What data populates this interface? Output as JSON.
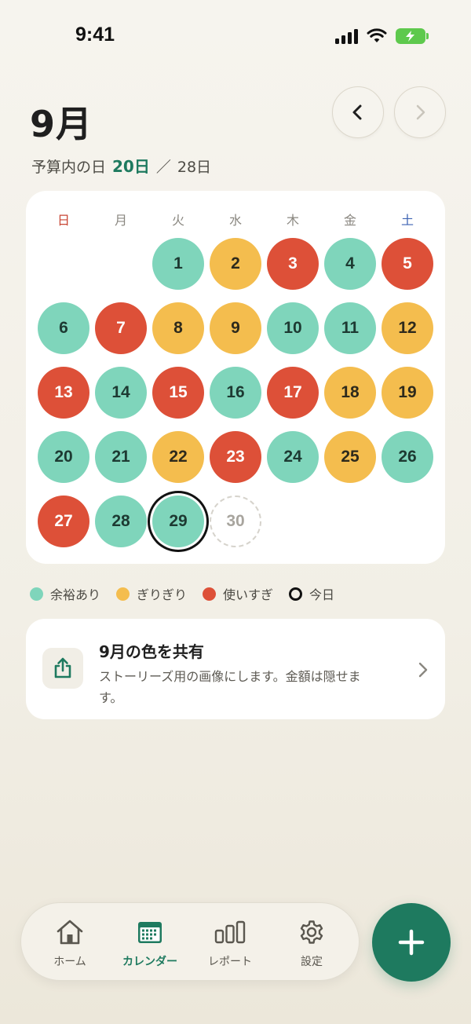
{
  "status_bar": {
    "time": "9:41"
  },
  "header": {
    "month_title": "9月",
    "budget_label": "予算内の日",
    "budget_days": "20日",
    "separator": "／",
    "total_days": "28日"
  },
  "calendar": {
    "weekdays": [
      "日",
      "月",
      "火",
      "水",
      "木",
      "金",
      "土"
    ],
    "days": [
      {
        "n": "1",
        "status": "green"
      },
      {
        "n": "2",
        "status": "yellow"
      },
      {
        "n": "3",
        "status": "red"
      },
      {
        "n": "4",
        "status": "green"
      },
      {
        "n": "5",
        "status": "red"
      },
      {
        "n": "6",
        "status": "green"
      },
      {
        "n": "7",
        "status": "red"
      },
      {
        "n": "8",
        "status": "yellow"
      },
      {
        "n": "9",
        "status": "yellow"
      },
      {
        "n": "10",
        "status": "green"
      },
      {
        "n": "11",
        "status": "green"
      },
      {
        "n": "12",
        "status": "yellow"
      },
      {
        "n": "13",
        "status": "red"
      },
      {
        "n": "14",
        "status": "green"
      },
      {
        "n": "15",
        "status": "red"
      },
      {
        "n": "16",
        "status": "green"
      },
      {
        "n": "17",
        "status": "red"
      },
      {
        "n": "18",
        "status": "yellow"
      },
      {
        "n": "19",
        "status": "yellow"
      },
      {
        "n": "20",
        "status": "green"
      },
      {
        "n": "21",
        "status": "green"
      },
      {
        "n": "22",
        "status": "yellow"
      },
      {
        "n": "23",
        "status": "red"
      },
      {
        "n": "24",
        "status": "green"
      },
      {
        "n": "25",
        "status": "yellow"
      },
      {
        "n": "26",
        "status": "green"
      },
      {
        "n": "27",
        "status": "red"
      },
      {
        "n": "28",
        "status": "green"
      },
      {
        "n": "29",
        "status": "green",
        "today": true
      },
      {
        "n": "30",
        "status": "empty"
      }
    ]
  },
  "legend": {
    "plenty": "余裕あり",
    "tight": "ぎりぎり",
    "over": "使いすぎ",
    "today": "今日"
  },
  "share_card": {
    "title": "9月の色を共有",
    "description": "ストーリーズ用の画像にします。金額は隠せます。"
  },
  "bottom_nav": {
    "tabs": [
      {
        "label": "ホーム",
        "icon": "home-icon",
        "active": false
      },
      {
        "label": "カレンダー",
        "icon": "calendar-icon",
        "active": true
      },
      {
        "label": "レポート",
        "icon": "bar-chart-icon",
        "active": false
      },
      {
        "label": "設定",
        "icon": "gear-icon",
        "active": false
      }
    ]
  },
  "colors": {
    "accent": "#1e7a5f",
    "green": "#7fd5bb",
    "yellow": "#f4bd4e",
    "red": "#dd5038"
  }
}
